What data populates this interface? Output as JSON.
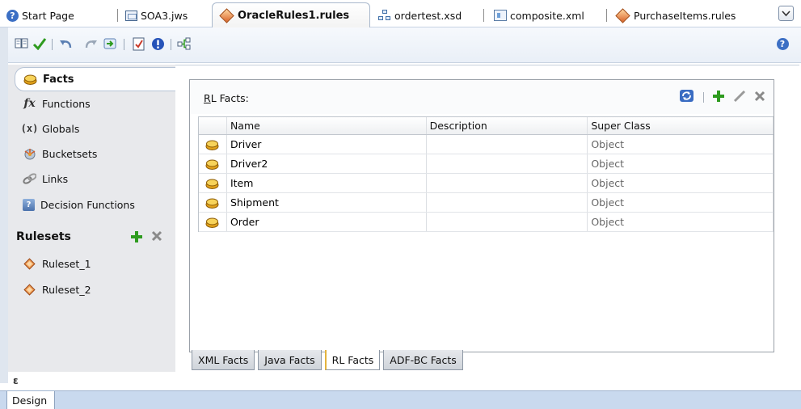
{
  "editor_tabs": [
    {
      "label": "Start Page",
      "icon": "help-icon"
    },
    {
      "label": "SOA3.jws",
      "icon": "workspace-icon"
    },
    {
      "label": "OracleRules1.rules",
      "icon": "rules-diamond-icon",
      "active": true
    },
    {
      "label": "ordertest.xsd",
      "icon": "schema-tree-icon"
    },
    {
      "label": "composite.xml",
      "icon": "composite-icon"
    },
    {
      "label": "PurchaseItems.rules",
      "icon": "rules-diamond-icon"
    }
  ],
  "toolbar": {
    "icons": [
      "book-icon",
      "validate-check-icon",
      "undo-icon",
      "redo-icon",
      "import-icon",
      "report-icon",
      "info-icon",
      "link-icon"
    ],
    "help_icon": "help-icon"
  },
  "sidebar": {
    "items": [
      {
        "label": "Facts",
        "icon": "facts-icon",
        "selected": true
      },
      {
        "label": "Functions",
        "icon": "fx-icon"
      },
      {
        "label": "Globals",
        "icon": "x-variable-icon"
      },
      {
        "label": "Bucketsets",
        "icon": "bucket-icon"
      },
      {
        "label": "Links",
        "icon": "chain-link-icon"
      },
      {
        "label": "Decision Functions",
        "icon": "decision-function-icon"
      }
    ],
    "rulesets_header": "Rulesets",
    "rulesets": [
      {
        "label": "Ruleset_1",
        "icon": "ruleset-icon"
      },
      {
        "label": "Ruleset_2",
        "icon": "ruleset-icon"
      }
    ],
    "collapse_glyph": "ε"
  },
  "facts_panel": {
    "title_mnemonic": "R",
    "title_rest": "L Facts:",
    "columns": [
      "Name",
      "Description",
      "Super Class"
    ],
    "rows": [
      {
        "name": "Driver",
        "description": "",
        "super_class": "Object"
      },
      {
        "name": "Driver2",
        "description": "",
        "super_class": "Object"
      },
      {
        "name": "Item",
        "description": "",
        "super_class": "Object"
      },
      {
        "name": "Shipment",
        "description": "",
        "super_class": "Object"
      },
      {
        "name": "Order",
        "description": "",
        "super_class": "Object"
      }
    ],
    "bottom_tabs": [
      {
        "label": "XML Facts"
      },
      {
        "label": "Java Facts"
      },
      {
        "label": "RL Facts",
        "active": true
      },
      {
        "label": "ADF-BC Facts"
      }
    ]
  },
  "status": {
    "design_tab": "Design"
  },
  "colors": {
    "accent_blue": "#3c6fc4",
    "add_green": "#2e9b1f",
    "delete_gray": "#8a8a8a",
    "rules_orange": "#d9642a",
    "statusbar_blue": "#c9d9ee"
  }
}
